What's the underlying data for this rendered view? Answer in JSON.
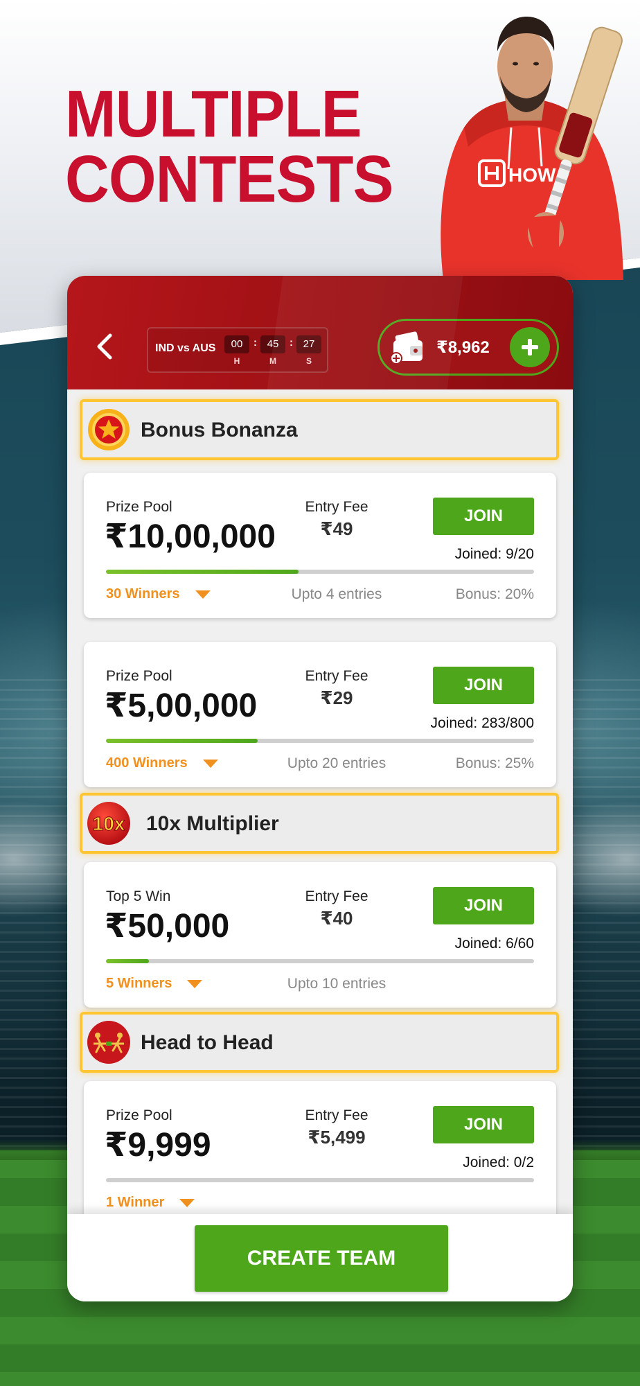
{
  "headline": {
    "line1": "MULTIPLE",
    "line2": "CONTESTS"
  },
  "player": {
    "jersey_logo_text": "HOW"
  },
  "header": {
    "match": "IND vs AUS",
    "timer": {
      "hours": "00",
      "minutes": "45",
      "seconds": "27",
      "hours_label": "H",
      "minutes_label": "M",
      "seconds_label": "S",
      "separator": ":"
    },
    "wallet_balance": "₹8,962"
  },
  "sections": [
    {
      "title": "Bonus Bonanza",
      "icon": "star-badge-icon",
      "contests": [
        {
          "label": "Prize Pool",
          "prize": "₹10,00,000",
          "fee_label": "Entry Fee",
          "fee": "₹49",
          "join": "JOIN",
          "joined": "Joined: 9/20",
          "progress": 0.45,
          "winners": "30 Winners",
          "entries": "Upto 4 entries",
          "bonus": "Bonus: 20%"
        },
        {
          "label": "Prize Pool",
          "prize": "₹5,00,000",
          "fee_label": "Entry Fee",
          "fee": "₹29",
          "join": "JOIN",
          "joined": "Joined: 283/800",
          "progress": 0.354,
          "winners": "400 Winners",
          "entries": "Upto 20 entries",
          "bonus": "Bonus: 25%"
        }
      ]
    },
    {
      "title": "10x Multiplier",
      "icon": "10x-badge-icon",
      "badge_text": "10x",
      "contests": [
        {
          "label": "Top 5 Win",
          "prize": "₹50,000",
          "fee_label": "Entry Fee",
          "fee": "₹40",
          "join": "JOIN",
          "joined": "Joined: 6/60",
          "progress": 0.1,
          "winners": "5 Winners",
          "entries": "Upto 10 entries",
          "bonus": ""
        }
      ]
    },
    {
      "title": "Head to Head",
      "icon": "tug-of-war-icon",
      "contests": [
        {
          "label": "Prize Pool",
          "prize": "₹9,999",
          "fee_label": "Entry Fee",
          "fee": "₹5,499",
          "join": "JOIN",
          "joined": "Joined: 0/2",
          "progress": 0,
          "winners": "1 Winner",
          "entries": "",
          "bonus": ""
        }
      ]
    }
  ],
  "footer": {
    "create_team": "CREATE TEAM"
  },
  "colors": {
    "brand_red": "#c8102e",
    "header_red": "#b5161b",
    "accent_green": "#4ea71b",
    "winners_orange": "#f0901e",
    "banner_gold": "#ffc533"
  }
}
